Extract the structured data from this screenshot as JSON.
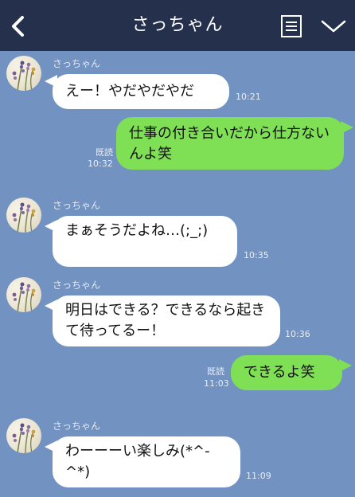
{
  "header": {
    "title": "さっちゃん",
    "back_icon": "chevron-left-icon",
    "menu_icon": "notes-icon",
    "dropdown_icon": "chevron-down-icon",
    "bg_color": "#25304c"
  },
  "chat": {
    "bg_color": "#7292c2",
    "incoming_bubble_color": "#ffffff",
    "outgoing_bubble_color": "#7fe055",
    "messages": [
      {
        "direction": "in",
        "sender": "さっちゃん",
        "text": "えー！やだやだやだ",
        "time": "10:21"
      },
      {
        "direction": "out",
        "text": "仕事の付き合いだから仕方ないんよ笑",
        "read": "既読",
        "time": "10:32"
      },
      {
        "direction": "in",
        "sender": "さっちゃん",
        "text": "まぁそうだよね…(;_;)",
        "time": "10:35"
      },
      {
        "direction": "in",
        "sender": "さっちゃん",
        "text": "明日はできる？できるなら起きて待ってるー！",
        "time": "10:36"
      },
      {
        "direction": "out",
        "text": "できるよ笑",
        "read": "既読",
        "time": "11:03"
      },
      {
        "direction": "in",
        "sender": "さっちゃん",
        "text": "わーーーい楽しみ(*^-^*)",
        "time": "11:09"
      }
    ]
  }
}
